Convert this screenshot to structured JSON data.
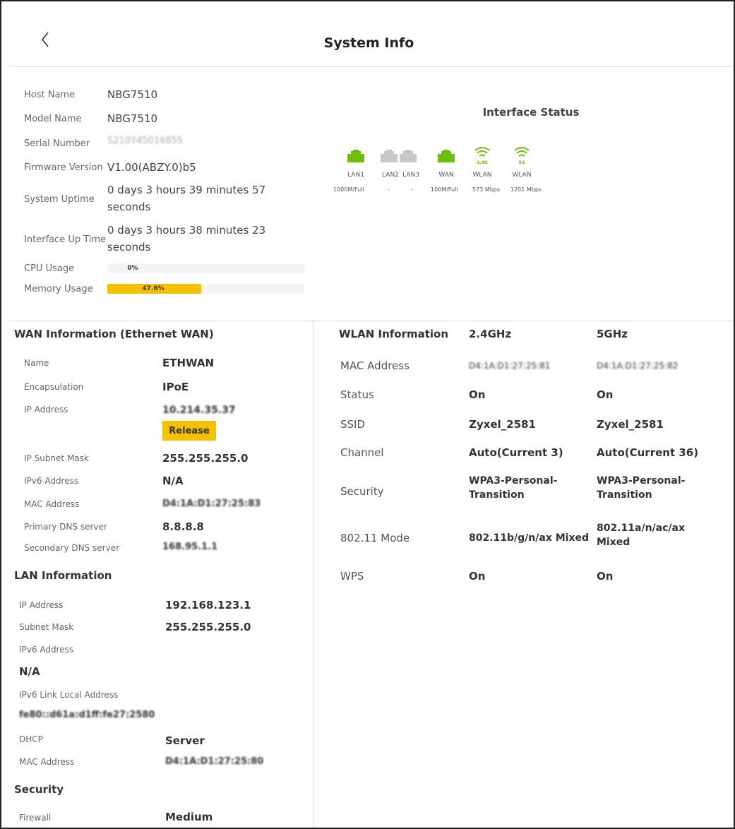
{
  "page": {
    "title": "System Info"
  },
  "system": {
    "host_name_label": "Host Name",
    "host_name": "NBG7510",
    "model_name_label": "Model Name",
    "model_name": "NBG7510",
    "serial_label": "Serial Number",
    "serial": "S210Y45016855",
    "firmware_label": "Firmware Version",
    "firmware": "V1.00(ABZY.0)b5",
    "uptime_label": "System Uptime",
    "uptime_line1": "0 days 3 hours 39 minutes 57",
    "uptime_line2": "seconds",
    "iface_uptime_label": "Interface Up Time",
    "iface_uptime_line1": "0 days 3 hours 38 minutes 23",
    "iface_uptime_line2": "seconds",
    "cpu_label": "CPU Usage",
    "cpu_text": "0%",
    "cpu_fraction": 0.0,
    "mem_label": "Memory Usage",
    "mem_text": "47.6%",
    "mem_fraction": 0.476
  },
  "interface_status": {
    "title": "Interface Status",
    "ports": [
      {
        "label": "LAN1",
        "speed": "1000M/Full",
        "connected": true
      },
      {
        "label": "LAN2",
        "speed": "-",
        "connected": false
      },
      {
        "label": "LAN3",
        "speed": "-",
        "connected": false
      },
      {
        "label": "WAN",
        "speed": "100M/Full",
        "connected": true
      },
      {
        "label": "WLAN",
        "band": "2.4G",
        "speed": "573 Mbps",
        "connected": true
      },
      {
        "label": "WLAN",
        "band": "5G",
        "speed": "1201 Mbps",
        "connected": true
      }
    ],
    "colors": {
      "connected": "#6cbf0c",
      "disconnected": "#c8c8c8"
    }
  },
  "wan": {
    "title": "WAN Information (Ethernet WAN)",
    "name_label": "Name",
    "name": "ETHWAN",
    "encap_label": "Encapsulation",
    "encap": "IPoE",
    "ip_label": "IP Address",
    "ip": "10.214.35.37",
    "release_label": "Release",
    "mask_label": "IP Subnet Mask",
    "mask": "255.255.255.0",
    "ipv6_label": "IPv6 Address",
    "ipv6": "N/A",
    "mac_label": "MAC Address",
    "mac": "D4:1A:D1:27:25:83",
    "dns1_label": "Primary DNS server",
    "dns1": "8.8.8.8",
    "dns2_label": "Secondary DNS server",
    "dns2": "168.95.1.1"
  },
  "lan": {
    "title": "LAN Information",
    "ip_label": "IP Address",
    "ip": "192.168.123.1",
    "mask_label": "Subnet Mask",
    "mask": "255.255.255.0",
    "ipv6_label": "IPv6 Address",
    "ipv6": "N/A",
    "ll_label": "IPv6 Link Local Address",
    "ll": "fe80::d61a:d1ff:fe27:2580",
    "dhcp_label": "DHCP",
    "dhcp": "Server",
    "mac_label": "MAC Address",
    "mac": "D4:1A:D1:27:25:80"
  },
  "security": {
    "title": "Security",
    "firewall_label": "Firewall",
    "firewall": "Medium"
  },
  "wlan": {
    "title": "WLAN Information",
    "band1": "2.4GHz",
    "band2": "5GHz",
    "mac_label": "MAC Address",
    "mac1": "D4:1A:D1:27:25:81",
    "mac2": "D4:1A:D1:27:25:82",
    "status_label": "Status",
    "status1": "On",
    "status2": "On",
    "ssid_label": "SSID",
    "ssid1": "Zyxel_2581",
    "ssid2": "Zyxel_2581",
    "channel_label": "Channel",
    "channel1": "Auto(Current 3)",
    "channel2": "Auto(Current 36)",
    "security_label": "Security",
    "security1_l1": "WPA3-Personal-",
    "security1_l2": "Transition",
    "security2_l1": "WPA3-Personal-",
    "security2_l2": "Transition",
    "mode_label": "802.11 Mode",
    "mode1": "802.11b/g/n/ax Mixed",
    "mode2_l1": "802.11a/n/ac/ax",
    "mode2_l2": "Mixed",
    "wps_label": "WPS",
    "wps1": "On",
    "wps2": "On"
  }
}
